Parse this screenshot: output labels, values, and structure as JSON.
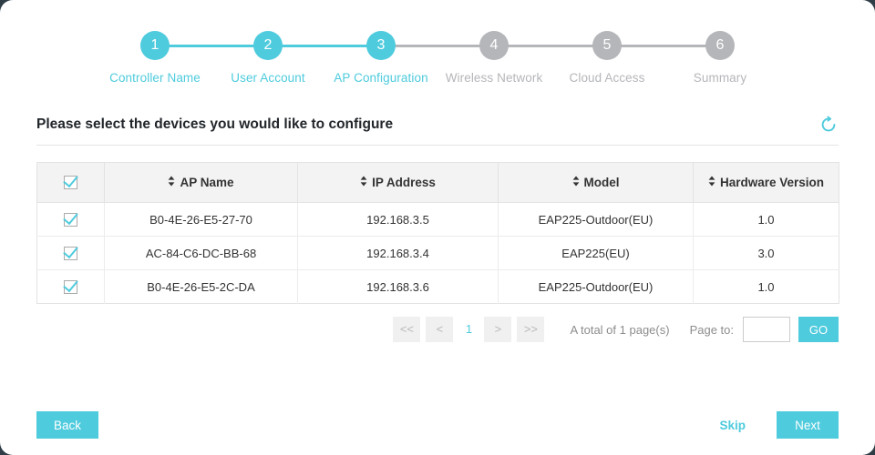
{
  "theme": {
    "accent": "#4ecbdd",
    "muted": "#b5b6ba",
    "page_bg": "#2e3d46"
  },
  "stepper": {
    "steps": [
      {
        "number": "1",
        "label": "Controller Name",
        "state": "done"
      },
      {
        "number": "2",
        "label": "User Account",
        "state": "done"
      },
      {
        "number": "3",
        "label": "AP Configuration",
        "state": "active"
      },
      {
        "number": "4",
        "label": "Wireless Network",
        "state": "pending"
      },
      {
        "number": "5",
        "label": "Cloud Access",
        "state": "pending"
      },
      {
        "number": "6",
        "label": "Summary",
        "state": "pending"
      }
    ]
  },
  "header": {
    "title": "Please select the devices you would like to configure",
    "refresh_icon": "refresh-icon"
  },
  "table": {
    "select_all_checked": true,
    "columns": [
      {
        "key": "check",
        "label": "",
        "sortable": false
      },
      {
        "key": "ap_name",
        "label": "AP Name",
        "sortable": true
      },
      {
        "key": "ip_address",
        "label": "IP Address",
        "sortable": true
      },
      {
        "key": "model",
        "label": "Model",
        "sortable": true
      },
      {
        "key": "hardware_version",
        "label": "Hardware Version",
        "sortable": true
      }
    ],
    "rows": [
      {
        "checked": true,
        "ap_name": "B0-4E-26-E5-27-70",
        "ip_address": "192.168.3.5",
        "model": "EAP225-Outdoor(EU)",
        "hardware_version": "1.0"
      },
      {
        "checked": true,
        "ap_name": "AC-84-C6-DC-BB-68",
        "ip_address": "192.168.3.4",
        "model": "EAP225(EU)",
        "hardware_version": "3.0"
      },
      {
        "checked": true,
        "ap_name": "B0-4E-26-E5-2C-DA",
        "ip_address": "192.168.3.6",
        "model": "EAP225-Outdoor(EU)",
        "hardware_version": "1.0"
      }
    ]
  },
  "pagination": {
    "first_label": "<<",
    "prev_label": "<",
    "current_page": "1",
    "next_label": ">",
    "last_label": ">>",
    "total_text": "A total of 1 page(s)",
    "page_to_label": "Page to:",
    "page_input_value": "",
    "page_input_placeholder": "",
    "go_label": "GO"
  },
  "footer": {
    "back_label": "Back",
    "skip_label": "Skip",
    "next_label": "Next"
  }
}
